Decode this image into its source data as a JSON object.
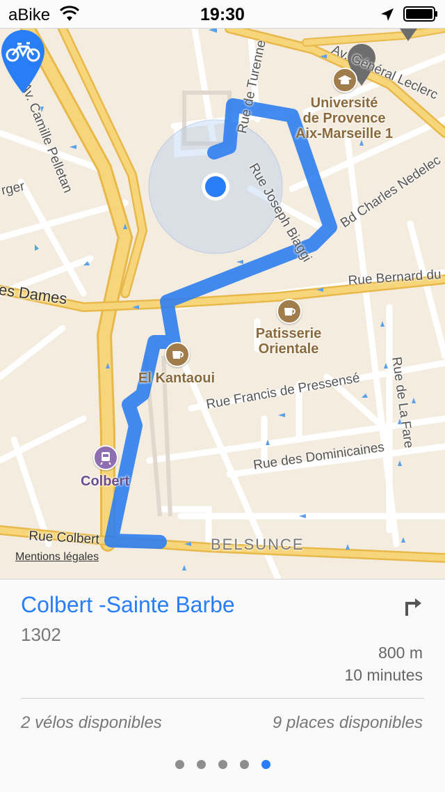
{
  "status_bar": {
    "carrier": "aBike",
    "time": "19:30"
  },
  "map": {
    "street_labels": [
      "Av. Camille Pelletan",
      "Rue de Turenne",
      "Av. Général Leclerc",
      "Rue Joseph Biaggi",
      "Bd Charles Nedelec",
      "rger",
      "es Dames",
      "Rue Bernard du",
      "Rue Francis de Pressensé",
      "Rue de La Fare",
      "Rue des Dominicaines",
      "Rue Colbert",
      "BELSUNCE"
    ],
    "poi": {
      "university": "Université\nde Provence\nAix-Marseille 1",
      "patisserie": "Patisserie\nOrientale",
      "kantaoui": "El Kantaoui",
      "colbert_station": "Colbert"
    },
    "mentions": "Mentions légales"
  },
  "station": {
    "name": "Colbert -Sainte Barbe",
    "code": "1302",
    "distance": "800 m",
    "duration": "10 minutes",
    "bikes_available": "2 vélos disponibles",
    "places_available": "9 places disponibles"
  },
  "pager": {
    "pages": 5,
    "active_page": 5
  },
  "colors": {
    "accent": "#2a7ef5",
    "route": "#2f7ef0",
    "map_bg": "#f3ecdf",
    "main_road": "#f7d57a"
  }
}
